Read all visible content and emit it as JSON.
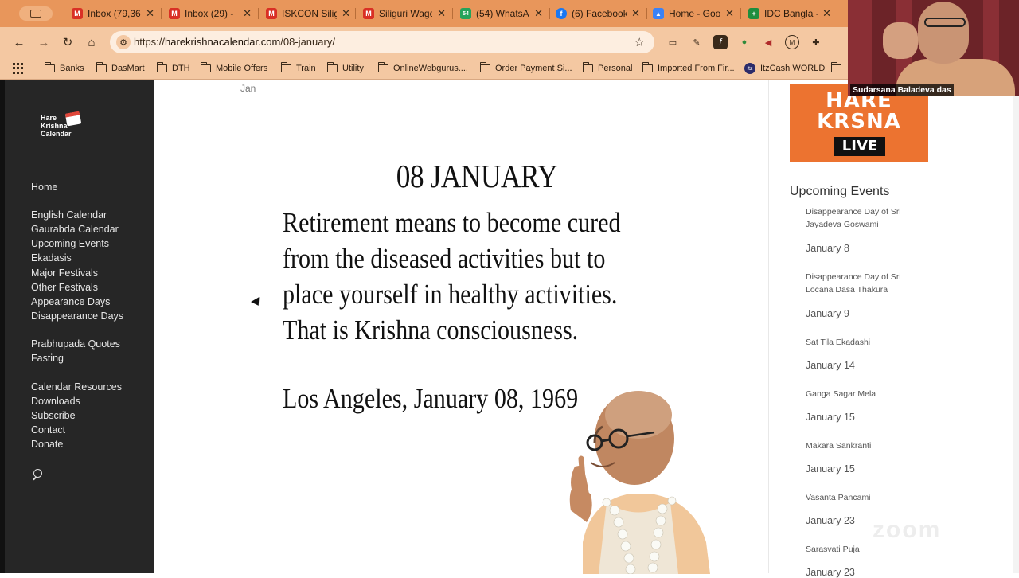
{
  "browser": {
    "tabs": [
      {
        "title": "Inbox (79,36",
        "icon": "gmail-icon",
        "color": "#d93025",
        "glyph": "M"
      },
      {
        "title": "Inbox (29) -",
        "icon": "gmail-icon",
        "color": "#d93025",
        "glyph": "M"
      },
      {
        "title": "ISKCON Silig",
        "icon": "gmail-icon",
        "color": "#d93025",
        "glyph": "M"
      },
      {
        "title": "Siliguri Wage",
        "icon": "gmail-icon",
        "color": "#d93025",
        "glyph": "M"
      },
      {
        "title": "(54) WhatsA",
        "icon": "whatsapp-icon",
        "color": "#25a35a",
        "glyph": "54"
      },
      {
        "title": "(6) Facebook",
        "icon": "facebook-icon",
        "color": "#1877f2",
        "glyph": "f"
      },
      {
        "title": "Home - Goo",
        "icon": "google-drive-icon",
        "color": "#3b82f6",
        "glyph": "▲"
      },
      {
        "title": "IDC Bangla -",
        "icon": "google-sheets-icon",
        "color": "#1e8e3e",
        "glyph": "+"
      }
    ],
    "url_scheme": "https://",
    "url_host": "harekrishnacalendar.com",
    "url_path": "/08-january/",
    "bookmarks": [
      "Banks",
      "DasMart",
      "DTH",
      "Mobile Offers",
      "Train",
      "Utility",
      "OnlineWebgurus....",
      "Order Payment Si...",
      "Personal",
      "Imported From Fir...",
      "ItzCash WORLD"
    ]
  },
  "sidebar": {
    "logo_text": "Hare Krishna Calendar",
    "links": [
      "Home",
      "English Calendar",
      "Gaurabda Calendar",
      "Upcoming Events",
      "Ekadasis",
      "Major Festivals",
      "Other Festivals",
      "Appearance Days",
      "Disappearance Days",
      "Prabhupada Quotes",
      "Fasting",
      "Calendar Resources",
      "Downloads",
      "Subscribe",
      "Contact",
      "Donate"
    ]
  },
  "main": {
    "breadcrumb": "Jan",
    "title": "08 JANUARY",
    "quote_lines": [
      "Retirement means to become cured",
      "from the diseased activities but to",
      "place yourself in healthy activities.",
      "That is Krishna consciousness."
    ],
    "place_date": "Los Angeles, January 08, 1969"
  },
  "right": {
    "banner_line1": "HARE",
    "banner_line2": "KRSNA",
    "banner_live": "LIVE",
    "upcoming_title": "Upcoming Events",
    "events": [
      {
        "name": "Disappearance Day of Sri Jayadeva Goswami",
        "date": "January 8"
      },
      {
        "name": "Disappearance Day of Sri Locana Dasa Thakura",
        "date": "January 9"
      },
      {
        "name": "Sat Tila Ekadashi",
        "date": "January 14"
      },
      {
        "name": "Ganga Sagar Mela",
        "date": "January 15"
      },
      {
        "name": "Makara Sankranti",
        "date": "January 15"
      },
      {
        "name": "Vasanta Pancami",
        "date": "January 23"
      },
      {
        "name": "Sarasvati Puja",
        "date": "January 23"
      }
    ],
    "watermark": "zoom"
  },
  "webcam": {
    "participant_name": "Sudarsana Baladeva das"
  }
}
